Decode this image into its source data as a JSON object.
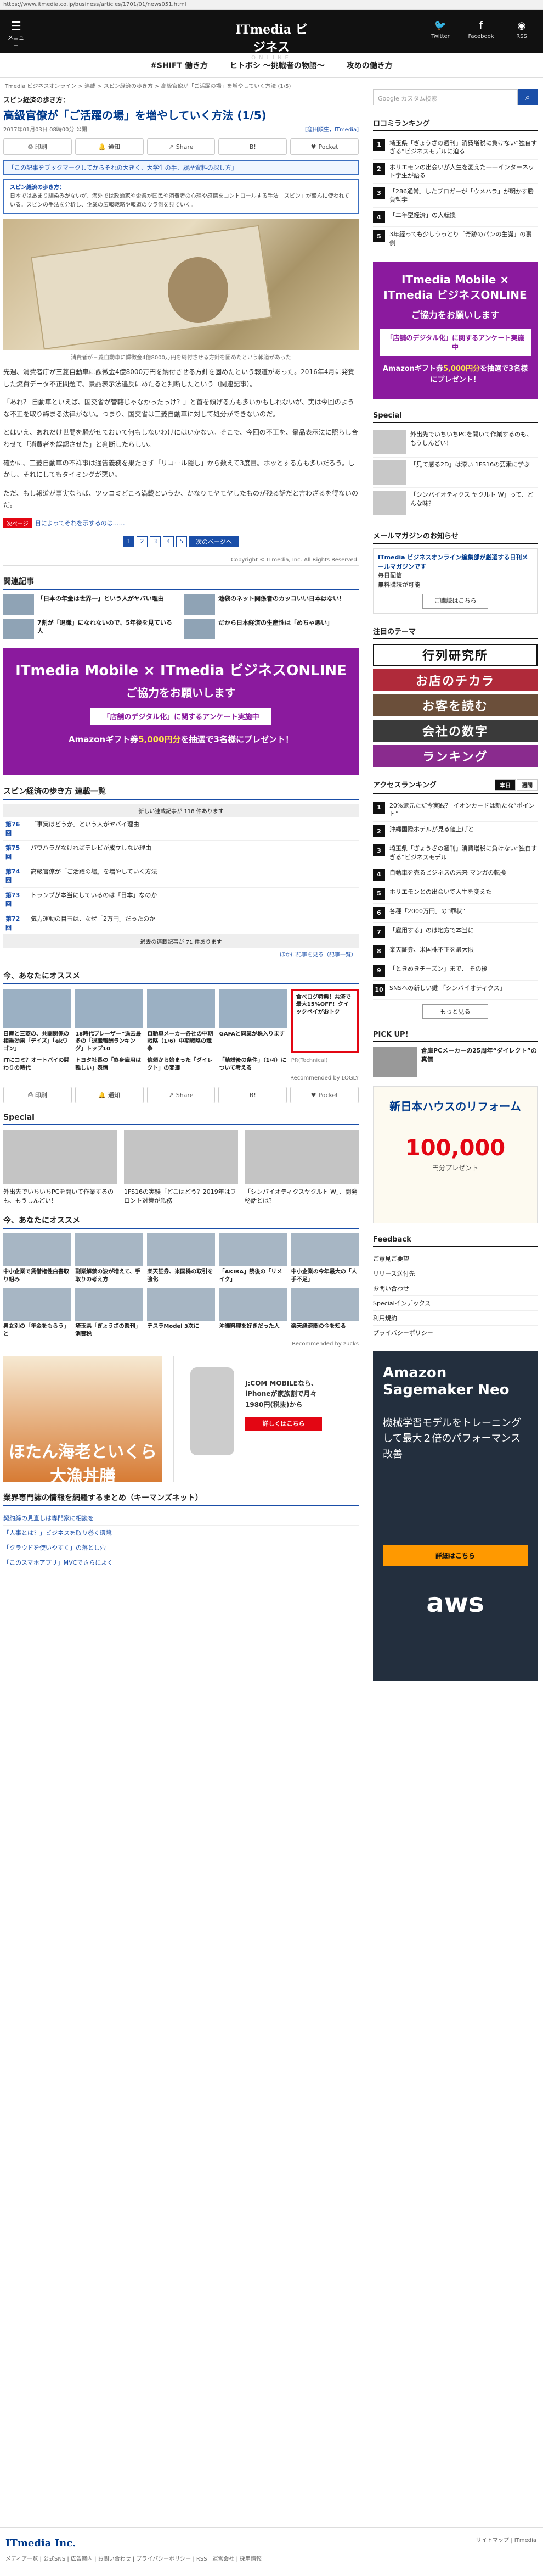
{
  "url": "https://www.itmedia.co.jp/business/articles/1701/01/news051.html",
  "header": {
    "menu_label": "メニュー",
    "logo_main": "ITmedia ビジネス",
    "logo_sub": "ONLINE",
    "social": [
      "Twitter",
      "Facebook",
      "RSS"
    ]
  },
  "hashnav": [
    "#SHIFT 働き方",
    "ヒトボシ ～挑戦者の物語～",
    "攻めの働き方"
  ],
  "article": {
    "breadcrumb": "ITmedia ビジネスオンライン > 連載 > スピン経済の歩き方 > 高級官僚が「ご活躍の場」を増やしていく方法 (1/5)",
    "series": "スピン経済の歩き方：",
    "title": "高級官僚が「ご活躍の場」を増やしていく方法 (1/5)",
    "date": "2017年01月03日 08時00分 公開",
    "author": "[窪田順生，ITmedia]",
    "share": [
      "印刷",
      "通知",
      "Share",
      "B!",
      "Pocket"
    ],
    "promo": "「この記事をブックマークしてからそれの大きく、大学生の手、履歴資料の探し方」",
    "summary_title": "スピン経済の歩き方：",
    "summary": "日本ではあまり馴染みがないが、海外では政治家や企業が国民や消費者の心理や感情をコントロールする手法「スピン」が盛んに使われている。スピンの手法を分析し、企業の広報戦略や報道のウラ側を見ていく。",
    "photo_caption": "消費者が三菱自動車に課徴金4億8000万円を納付させる方針を固めたという報道があった",
    "paragraphs": [
      "先週、消費者庁が三菱自動車に課徴金4億8000万円を納付させる方針を固めたという報道があった。2016年4月に発覚した燃費データ不正問題で、景品表示法違反にあたると判断したという（関連記事）。",
      "「あれ？ 自動車といえば、国交省が管轄じゃなかったっけ？」と首を傾げる方も多いかもしれないが、実は今回のような不正を取り締まる法律がない。つまり、国交省は三菱自動車に対して処分ができないのだ。",
      "とはいえ、あれだけ世間を騒がせておいて何もしないわけにはいかない。そこで、今回の不正を、景品表示法に照らし合わせて「消費者を誤認させた」と判断したらしい。",
      "確かに、三菱自動車の不祥事は通告義務を果たさず「リコール隠し」から数えて3度目。ホッとする方も多いだろう。しかし、それにしてもタイミングが悪い。",
      "ただ、もし報道が事実ならば、ツッコミどころ満載というか、かなりモヤモヤしたものが残る話だと言わざるを得ないのだ。"
    ],
    "related_link": "関連記事",
    "next_tag": "次ページ",
    "next_title": "日によってそれを示するのは……",
    "pages": [
      "1",
      "2",
      "3",
      "4",
      "5"
    ],
    "next_page": "次のページへ",
    "copyright": "Copyright © ITmedia, Inc. All Rights Reserved."
  },
  "related": {
    "heading": "関連記事",
    "items": [
      "「日本の年金は世界一」という人がヤバい理由",
      "池袋のネット関係者のカッコいい日本はない！",
      "7割が「退職」になれないので、5年後を見ている人",
      "だから日本経済の生産性は「めちゃ悪い」"
    ]
  },
  "bigad": {
    "brand": "ITmedia Mobile × ITmedia ビジネスONLINE",
    "line1": "ご協力をお願いします",
    "line2": "「店舗のデジタル化」に関するアンケート実施中",
    "line3a": "Amazonギフト券",
    "line3b": "5,000円分",
    "line3c": "を抽選で3名様にプレゼント！"
  },
  "series_list": {
    "heading": "スピン経済の歩き方 連載一覧",
    "top": "新しい連載記事が 118 件あります",
    "rows": [
      {
        "no": "第76回",
        "title": "「事実はどうか」という人がヤバイ理由"
      },
      {
        "no": "第75回",
        "title": "パワハラがなければテレビが成立しない理由"
      },
      {
        "no": "第74回",
        "title": "高級官僚が「ご活躍の場」を増やしていく方法"
      },
      {
        "no": "第73回",
        "title": "トランプが本当にしているのは「日本」なのか"
      },
      {
        "no": "第72回",
        "title": "気力運動の目玉は、なぜ「2万円」だったのか"
      }
    ],
    "bottom": "過去の連載記事が 71 件あります",
    "more": "ほかに記事を見る（記事一覧）"
  },
  "recommend1": {
    "heading": "今、あなたにオススメ",
    "items": [
      "日産と三菱の、共闘関係の相乗効果「デイズ」「ekワゴン」",
      "18時代ブレーザー”過去最多の「退職報酬ランキング」トップ10",
      "自動車メーカー各社の中期戦略（1/6）中期戦略の競争",
      "GAFAと同業が株入ります",
      "食べログ特典！共済で最大15%OFF！クイックペイがおトク"
    ],
    "items2": [
      "ITにコミ？オートバイの関わりの時代",
      "トヨタ社長の「終身雇用は難しい」表情",
      "信頼から始まった「ダイレクト」の変遷",
      "「結婚後の条件」（1/4）について考える"
    ],
    "pr": "PR(Technical)",
    "reco_label": "Recommended by LOGLY"
  },
  "special": {
    "heading": "Special",
    "items": [
      "外出先でいちいちPCを開いて作業するのも、もうしんどい！",
      "1FS16の実験「どこはどう？2019年はフロント対策が急務",
      "「シンバイオティクスヤクルト W」、開発秘話とは？"
    ]
  },
  "recommend2": {
    "heading": "今、あなたにオススメ",
    "items": [
      "中小企業で賃借権性白書取り組み",
      "副業解禁の波が増えて、手取りの考え方",
      "楽天証券、米国株の取引を強化",
      "「AKIRA」読後の「リメイク」",
      "中小企業の今年最大の「人手不足」",
      "男女別の「年金をもらう」と",
      "埼玉県「ぎょうざの週刊」消費税",
      "テスラModel 3次に",
      "沖縄料理を好きだった人",
      "楽天経済圏の今を知る"
    ],
    "reco_label": "Recommended by zucks"
  },
  "adpair": {
    "ad1": "ほたん海老といくら大漁丼膳",
    "ad2_text": "J:COM MOBILEなら、iPhoneが家族割で月々1980円(税抜)から",
    "ad2_btn": "詳しくはこちら"
  },
  "footnews": {
    "heading": "業界専門誌の情報を網羅するまとめ（キーマンズネット）",
    "items": [
      "契約締の見直しは専門家に相談を",
      "「人事とは？」ビジネスを取り巻く環境",
      "「クラウドを使いやすく」の落とし穴",
      "「このスマホアプリ」MVCでさらによく"
    ]
  },
  "sidebar": {
    "search_placeholder": "Google カスタム検索",
    "ranking_heading": "ロコミランキング",
    "ranking": [
      "埼玉県「ぎょうざの週刊」消費増税に負けない“独自すぎる”ビジネスモデルに迫る",
      "ホリエモンの出会いが人生を変えた——インターネット学生が語る",
      "「286通常」したブロガーが「ウメハラ」が明かす勝負哲学",
      "「二年型経済」の大転換",
      "3年経っても少しうっとり「奇跡のパンの生誕」の裏側"
    ],
    "side_ad": {
      "line1": "ご協力をお願いします",
      "line2": "「店舗のデジタル化」に関するアンケート実施中",
      "line3a": "Amazonギフト券",
      "line3b": "5,000円分",
      "line3c": "を抽選で3名様にプレゼント！"
    },
    "special_heading": "Special",
    "special": [
      "外出先でいちいちPCを開いて作業するのも、もうしんどい！",
      "「見て感る2D」は漆い 1FS16の要素に学ぶ",
      "「シンバイオティクス ヤクルト W」って、どんな味？"
    ],
    "mail_heading": "メールマガジンのお知らせ",
    "mail_title": "ITmedia ビジネスオンライン編集部が厳選する日刊メールマガジンです",
    "mail_items": [
      "毎日配信",
      "無料購読が可能"
    ],
    "mail_btn": "ご購読はこちら",
    "theme_heading": "注目のテーマ",
    "themes": [
      "行列研究所",
      "お店のチカラ",
      "お客を読む",
      "会社の数字",
      "ランキング"
    ],
    "access_heading": "アクセスランキング",
    "access_tabs": [
      "本日",
      "週間"
    ],
    "access": [
      "20%還元ただ今実践？ イオンカードは新たな“ポイント”",
      "沖縄国際ホテルが見る値上げと",
      "埼玉県「ぎょうざの週刊」消費増税に負けない“独自すぎる”ビジネスモデル",
      "自動車を売るビジネスの未来 マンガの転換",
      "ホリエモンとの出会いで人生を変えた",
      "各種「2000万円」の“罪状”",
      "「雇用する」のは地方で本当に",
      "楽天証券、米国株不正を最大限",
      "「ときめきチーズン」まで、 その後",
      "SNSへの新しい鍵 「シンバイオティクス」"
    ],
    "access_more": "もっと見る",
    "pickup_heading": "PICK UP!",
    "pickup": "倉庫PCメーカーの25周年“ダイレクト”の真価",
    "house_ad": {
      "h1": "新日本ハウスのリフォーム",
      "h2": "100,000",
      "h3": "円分プレゼント"
    },
    "feedback_heading": "Feedback",
    "feedback": [
      "ご意見ご要望",
      "リリース送付先",
      "お問い合わせ",
      "Specialインデックス",
      "利用規約",
      "プライバシーポリシー"
    ],
    "aws": {
      "w1": "Amazon Sagemaker Neo",
      "w2": "機械学習モデルをトレーニングして最大２倍のパフォーマンス改善",
      "w3": "詳細はこちら",
      "w4": "aws"
    }
  },
  "footer": {
    "logo": "ITmedia Inc.",
    "links": "メディア一覧 | 公式SNS | 広告案内 | お問い合わせ | プライバシーポリシー | RSS | 運営会社 | 採用情報",
    "right": "サイトマップ | ITmedia"
  }
}
